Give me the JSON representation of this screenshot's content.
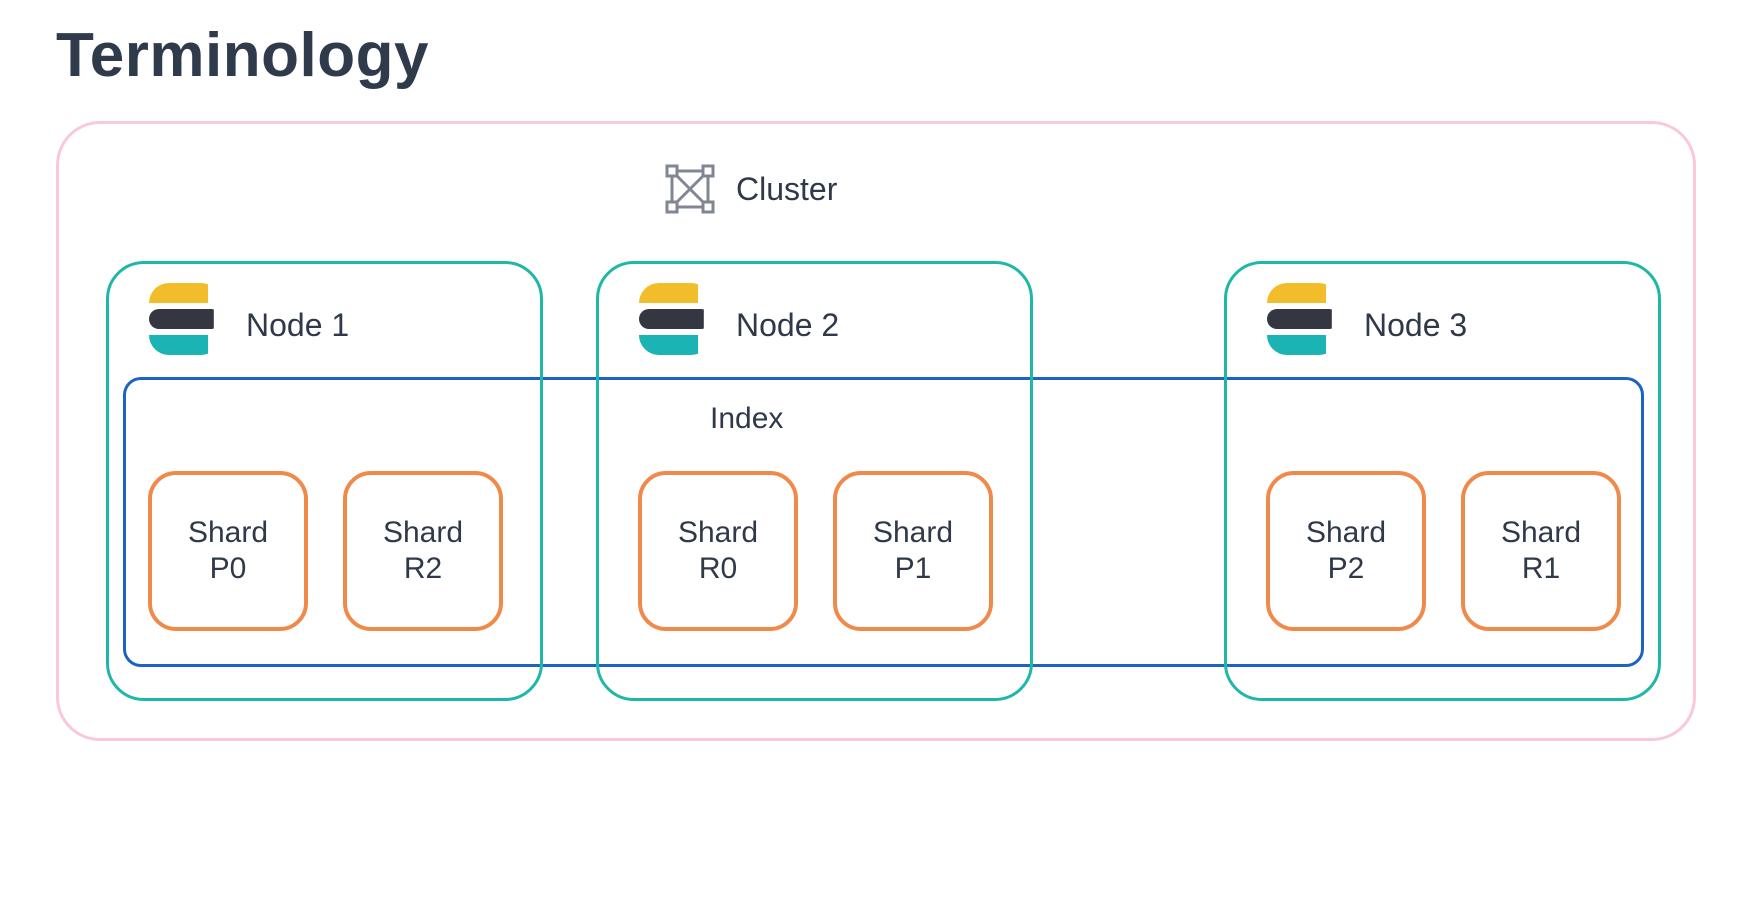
{
  "title": "Terminology",
  "cluster": {
    "label": "Cluster"
  },
  "index": {
    "label": "Index"
  },
  "nodes": [
    {
      "label": "Node 1",
      "shards": [
        {
          "line1": "Shard",
          "line2": "P0"
        },
        {
          "line1": "Shard",
          "line2": "R2"
        }
      ]
    },
    {
      "label": "Node 2",
      "shards": [
        {
          "line1": "Shard",
          "line2": "R0"
        },
        {
          "line1": "Shard",
          "line2": "P1"
        }
      ]
    },
    {
      "label": "Node 3",
      "shards": [
        {
          "line1": "Shard",
          "line2": "P2"
        },
        {
          "line1": "Shard",
          "line2": "R1"
        }
      ]
    }
  ],
  "colors": {
    "cluster_border": "#f9c9d8",
    "node_border": "#1fb8a8",
    "index_border": "#1c63c4",
    "shard_border": "#f08a4b"
  }
}
